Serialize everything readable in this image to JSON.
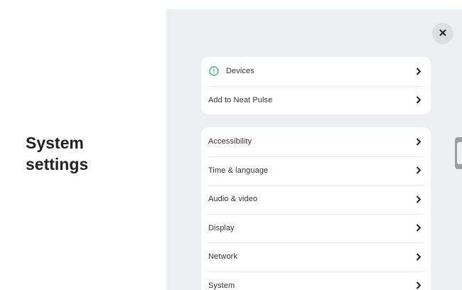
{
  "page": {
    "title": "System\nsettings"
  },
  "colors": {
    "panel_bg": "#eeeff1",
    "card_bg": "#ffffff",
    "status_accent": "#3bb38a",
    "text": "#333333"
  },
  "close_button": {
    "icon": "close-icon"
  },
  "top_section": {
    "items": [
      {
        "label": "Devices",
        "icon": "info-circle-icon"
      },
      {
        "label": "Add to Neat Pulse"
      }
    ]
  },
  "main_section": {
    "items": [
      {
        "label": "Accessibility"
      },
      {
        "label": "Time & language"
      },
      {
        "label": "Audio & video"
      },
      {
        "label": "Display"
      },
      {
        "label": "Network"
      },
      {
        "label": "System"
      }
    ]
  }
}
